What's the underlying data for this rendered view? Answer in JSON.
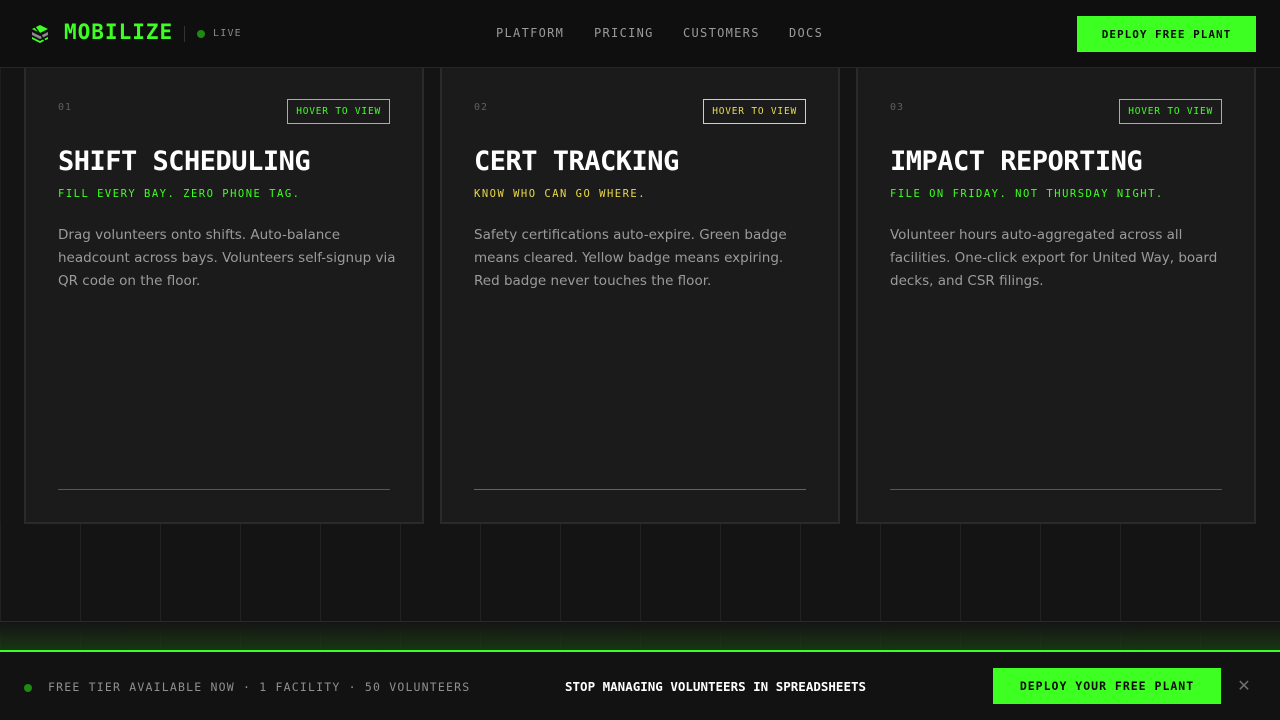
{
  "nav": {
    "brand": "MOBILIZE",
    "status": "LIVE",
    "links": [
      "PLATFORM",
      "PRICING",
      "CUSTOMERS",
      "DOCS"
    ],
    "cta": "DEPLOY FREE PLANT"
  },
  "features": [
    {
      "number": "01",
      "badge": "HOVER TO VIEW",
      "title": "SHIFT SCHEDULING",
      "subtitle": "FILL EVERY BAY. ZERO PHONE TAG.",
      "body": "Drag volunteers onto shifts. Auto-balance headcount across bays. Volunteers self-signup via QR code on the floor.",
      "accent": "#3dff22"
    },
    {
      "number": "02",
      "badge": "HOVER TO VIEW",
      "title": "CERT TRACKING",
      "subtitle": "KNOW WHO CAN GO WHERE.",
      "body": "Safety certifications auto-expire. Green badge means cleared. Yellow badge means expiring. Red badge never touches the floor.",
      "accent": "#e9d84a"
    },
    {
      "number": "03",
      "badge": "HOVER TO VIEW",
      "title": "IMPACT REPORTING",
      "subtitle": "FILE ON FRIDAY. NOT THURSDAY NIGHT.",
      "body": "Volunteer hours auto-aggregated across all facilities. One-click export for United Way, board decks, and CSR filings.",
      "accent": "#3dff22"
    }
  ],
  "bottom_bar": {
    "tier_text": "FREE TIER AVAILABLE NOW · 1 FACILITY · 50 VOLUNTEERS",
    "headline": "STOP MANAGING VOLUNTEERS IN SPREADSHEETS",
    "cta": "DEPLOY YOUR FREE PLANT",
    "close": "✕"
  },
  "colors": {
    "brand_green": "#3dff22",
    "warning_yellow": "#e9d84a",
    "background": "#141414"
  }
}
